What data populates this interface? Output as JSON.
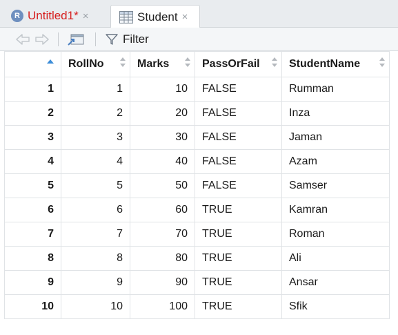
{
  "tabs": [
    {
      "label": "Untitled1*",
      "close": "×"
    },
    {
      "label": "Student",
      "close": "×"
    }
  ],
  "toolbar": {
    "filter_label": "Filter"
  },
  "table": {
    "columns": [
      "",
      "RollNo",
      "Marks",
      "PassOrFail",
      "StudentName"
    ],
    "rows": [
      {
        "id": "1",
        "RollNo": "1",
        "Marks": "10",
        "PassOrFail": "FALSE",
        "StudentName": "Rumman"
      },
      {
        "id": "2",
        "RollNo": "2",
        "Marks": "20",
        "PassOrFail": "FALSE",
        "StudentName": "Inza"
      },
      {
        "id": "3",
        "RollNo": "3",
        "Marks": "30",
        "PassOrFail": "FALSE",
        "StudentName": "Jaman"
      },
      {
        "id": "4",
        "RollNo": "4",
        "Marks": "40",
        "PassOrFail": "FALSE",
        "StudentName": "Azam"
      },
      {
        "id": "5",
        "RollNo": "5",
        "Marks": "50",
        "PassOrFail": "FALSE",
        "StudentName": "Samser"
      },
      {
        "id": "6",
        "RollNo": "6",
        "Marks": "60",
        "PassOrFail": "TRUE",
        "StudentName": "Kamran"
      },
      {
        "id": "7",
        "RollNo": "7",
        "Marks": "70",
        "PassOrFail": "TRUE",
        "StudentName": "Roman"
      },
      {
        "id": "8",
        "RollNo": "8",
        "Marks": "80",
        "PassOrFail": "TRUE",
        "StudentName": "Ali"
      },
      {
        "id": "9",
        "RollNo": "9",
        "Marks": "90",
        "PassOrFail": "TRUE",
        "StudentName": "Ansar"
      },
      {
        "id": "10",
        "RollNo": "10",
        "Marks": "100",
        "PassOrFail": "TRUE",
        "StudentName": "Sfik"
      }
    ]
  },
  "colors": {
    "modified_tab": "#d61f1f",
    "sort_active": "#3c8dd8",
    "sort_inactive": "#b5b9be"
  },
  "icons": [
    "r-script-icon",
    "data-grid-icon",
    "back-arrow-icon",
    "forward-arrow-icon",
    "popout-icon",
    "filter-icon",
    "sort-icon"
  ]
}
